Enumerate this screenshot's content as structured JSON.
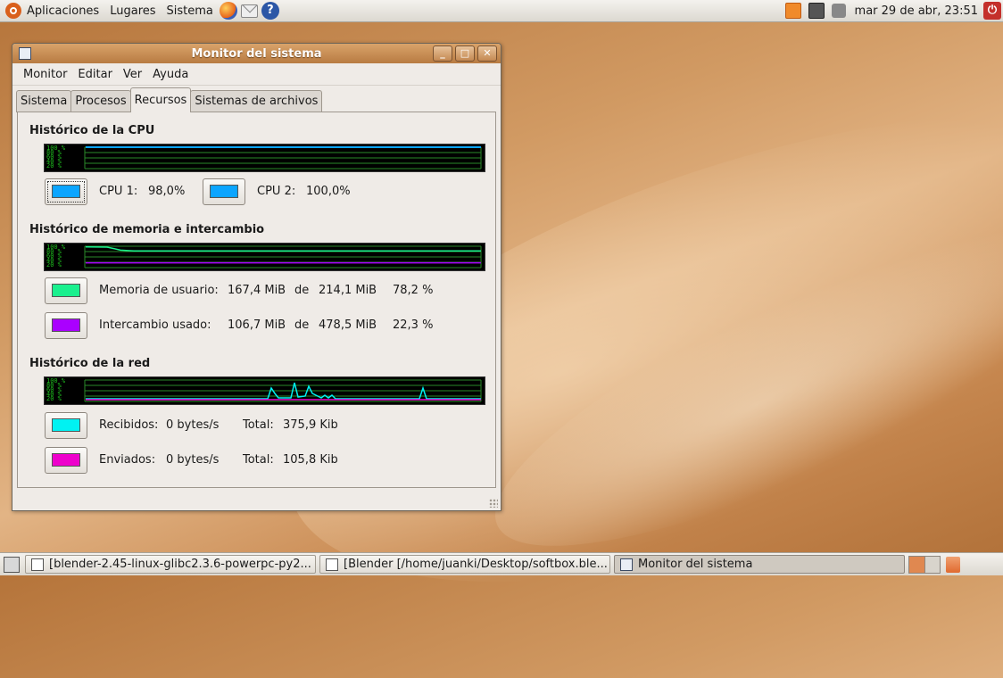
{
  "top_panel": {
    "menus": [
      "Aplicaciones",
      "Lugares",
      "Sistema"
    ],
    "clock": "mar 29 de abr, 23:51"
  },
  "window": {
    "title": "Monitor del sistema",
    "menubar": [
      "Monitor",
      "Editar",
      "Ver",
      "Ayuda"
    ],
    "tabs": [
      "Sistema",
      "Procesos",
      "Recursos",
      "Sistemas de archivos"
    ],
    "active_tab": "Recursos",
    "cpu": {
      "title": "Histórico de la CPU",
      "graph_ticks": [
        "100 %",
        "80 %",
        "60 %",
        "40 %",
        "20 %"
      ],
      "cpu1_label": "CPU 1:",
      "cpu1_value": "98,0%",
      "cpu2_label": "CPU 2:",
      "cpu2_value": "100,0%",
      "color": "#0ba5ff",
      "usage_pct": [
        98,
        100
      ]
    },
    "memory": {
      "title": "Histórico de memoria e intercambio",
      "user_label": "Memoria de usuario:",
      "user_used": "167,4 MiB",
      "of": "de",
      "user_total": "214,1 MiB",
      "user_pct": "78,2 %",
      "swap_label": "Intercambio usado:",
      "swap_used": "106,7 MiB",
      "swap_total": "478,5 MiB",
      "swap_pct": "22,3 %",
      "user_color": "#1af08e",
      "swap_color": "#aa00ff",
      "user_fraction": 0.782,
      "swap_fraction": 0.223
    },
    "network": {
      "title": "Histórico de la red",
      "recv_label": "Recibidos:",
      "recv_rate": "0 bytes/s",
      "total_label": "Total:",
      "recv_total": "375,9 Kib",
      "sent_label": "Enviados:",
      "sent_rate": "0 bytes/s",
      "sent_total": "105,8 Kib",
      "recv_color": "#00f2f2",
      "sent_color": "#ee00cc"
    }
  },
  "taskbar": {
    "tasks": [
      "[blender-2.45-linux-glibc2.3.6-powerpc-py2...",
      "[Blender [/home/juanki/Desktop/softbox.ble...",
      "Monitor del sistema"
    ]
  }
}
